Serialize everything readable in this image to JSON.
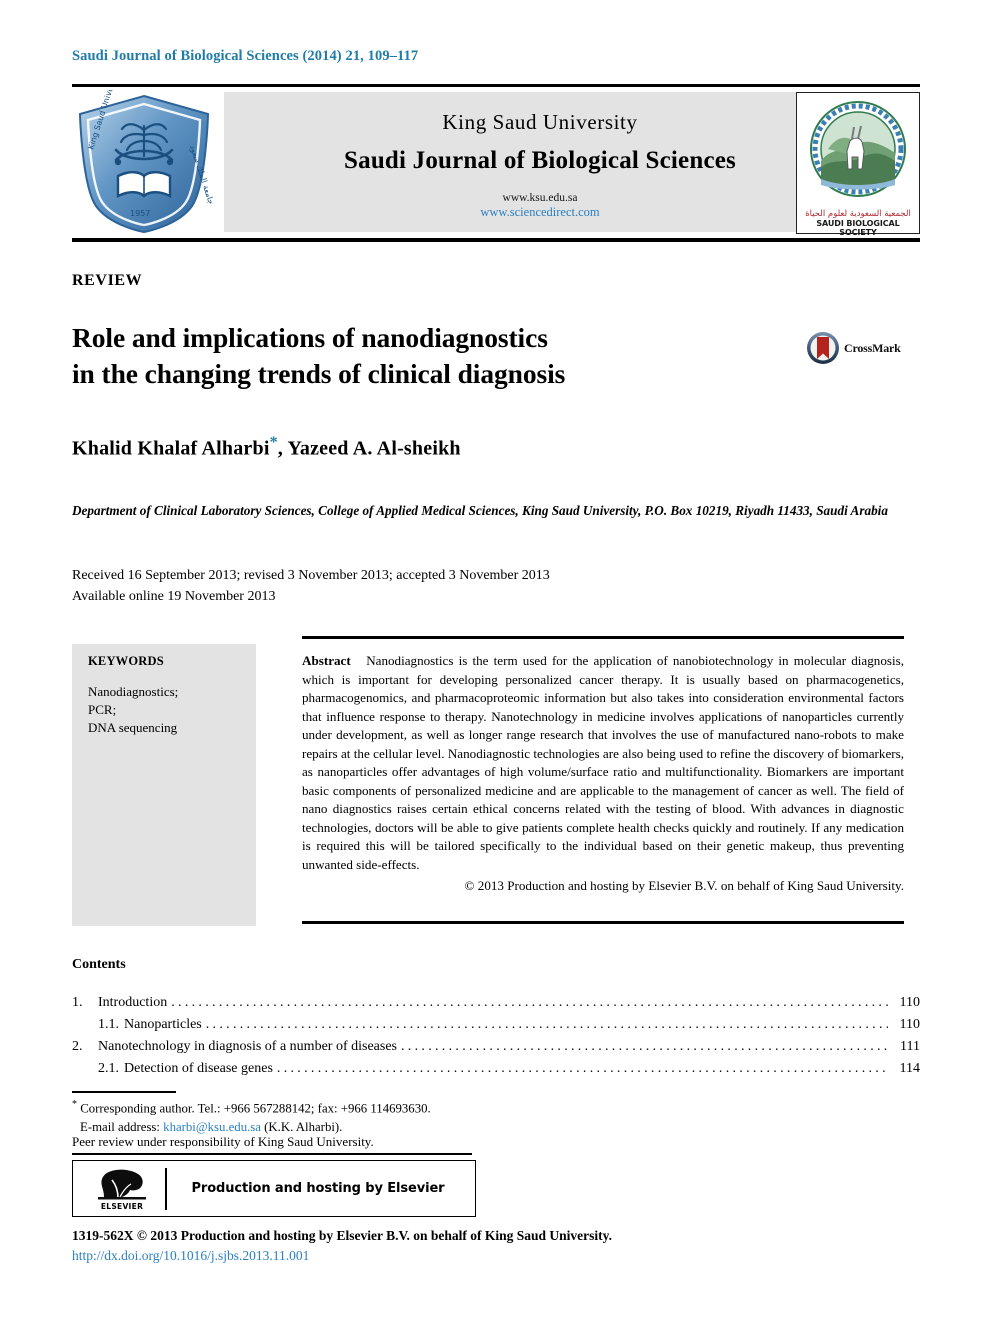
{
  "running_head": "Saudi Journal of Biological Sciences (2014) 21, 109–117",
  "header": {
    "university": "King Saud University",
    "journal_title": "Saudi Journal of Biological Sciences",
    "url_university": "www.ksu.edu.sa",
    "url_sciencedirect": "www.sciencedirect.com",
    "ksu_logo_alt": "King Saud University shield logo",
    "society_arabic": "الجمعية السعودية لعلوم الحياة",
    "society_english": "SAUDI BIOLOGICAL SOCIETY"
  },
  "article": {
    "kind": "REVIEW",
    "title_line1": "Role and implications of nanodiagnostics",
    "title_line2": "in the changing trends of clinical diagnosis",
    "crossmark_label": "CrossMark",
    "authors": "Khalid Khalaf Alharbi",
    "authors_rest": ", Yazeed A. Al-sheikh",
    "corresponding_marker": "*",
    "affiliation": "Department of Clinical Laboratory Sciences, College of Applied Medical Sciences, King Saud University, P.O. Box 10219, Riyadh 11433, Saudi Arabia",
    "history_line1": "Received 16 September 2013; revised 3 November 2013; accepted 3 November 2013",
    "history_line2": "Available online 19 November 2013"
  },
  "keywords": {
    "heading": "KEYWORDS",
    "items": "Nanodiagnostics;\nPCR;\nDNA sequencing"
  },
  "abstract": {
    "label": "Abstract",
    "text": "Nanodiagnostics is the term used for the application of nanobiotechnology in molecular diagnosis, which is important for developing personalized cancer therapy. It is usually based on pharmacogenetics, pharmacogenomics, and pharmacoproteomic information but also takes into consideration environmental factors that influence response to therapy. Nanotechnology in medicine involves applications of nanoparticles currently under development, as well as longer range research that involves the use of manufactured nano-robots to make repairs at the cellular level. Nanodiagnostic technologies are also being used to refine the discovery of biomarkers, as nanoparticles offer advantages of high volume/surface ratio and multifunctionality. Biomarkers are important basic components of personalized medicine and are applicable to the management of cancer as well. The field of nano diagnostics raises certain ethical concerns related with the testing of blood. With advances in diagnostic technologies, doctors will be able to give patients complete health checks quickly and routinely. If any medication is required this will be tailored specifically to the individual based on their genetic makeup, thus preventing unwanted side-effects.",
    "copyright": "© 2013 Production and hosting by Elsevier B.V. on behalf of King Saud University."
  },
  "contents": {
    "heading": "Contents",
    "entries": [
      {
        "num": "1.",
        "label": "Introduction",
        "page": "110",
        "sub": false
      },
      {
        "num": "1.1.",
        "label": "Nanoparticles",
        "page": "110",
        "sub": true
      },
      {
        "num": "2.",
        "label": "Nanotechnology in diagnosis of a number of diseases",
        "page": "111",
        "sub": false
      },
      {
        "num": "2.1.",
        "label": "Detection of disease genes",
        "page": "114",
        "sub": true
      }
    ]
  },
  "footnotes": {
    "corresponding": "Corresponding author. Tel.: +966 567288142; fax: +966 114693630.",
    "email_label": "E-mail address:",
    "email": "kharbi@ksu.edu.sa",
    "email_suffix": "(K.K. Alharbi).",
    "peer_review": "Peer review under responsibility of King Saud University.",
    "elsevier_logo_word": "ELSEVIER",
    "elsevier_box_text": "Production and hosting by Elsevier"
  },
  "bottom": {
    "issn_line": "1319-562X © 2013 Production and hosting by Elsevier B.V. on behalf of King Saud University.",
    "doi": "http://dx.doi.org/10.1016/j.sjbs.2013.11.001"
  },
  "colors": {
    "link_blue": "#2b7fc0",
    "runhead_blue": "#1f7ba8",
    "band_gray": "#e3e3e3"
  }
}
